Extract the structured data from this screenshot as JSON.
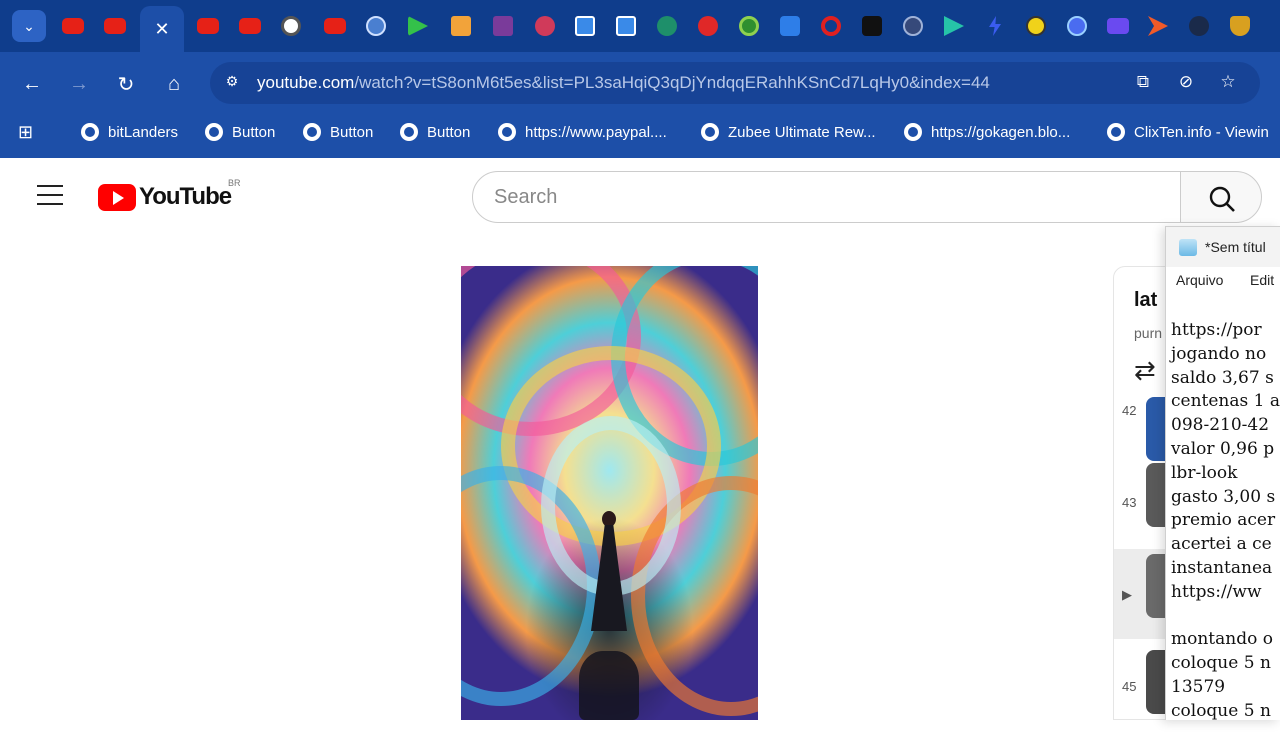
{
  "browser": {
    "tab_count_icons": [
      "youtube-favicon",
      "youtube-favicon",
      "close-tab",
      "youtube-favicon",
      "youtube-favicon",
      "wordpress-favicon",
      "youtube-favicon",
      "globe-favicon",
      "play-favicon",
      "orange-favicon",
      "shield-favicon",
      "red-circle-favicon",
      "blue-square-favicon",
      "blue-square-favicon",
      "green-t-favicon",
      "red-heart-favicon",
      "green-circle-favicon",
      "c-favicon",
      "red-swirl-favicon",
      "tiktok-favicon",
      "dark-globe-favicon",
      "teal-play-favicon",
      "blue-bolt-favicon",
      "yellow-check-favicon",
      "c-blue-favicon",
      "purple-video-favicon",
      "orange-arrow-favicon",
      "dark-circle-favicon",
      "gold-shield-favicon"
    ],
    "active_tab_close": "✕",
    "url_domain": "youtube.com",
    "url_rest": "/watch?v=tS8onM6t5es&list=PL3saHqiQ3qDjYndqqERahhKSnCd7LqHy0&index=44",
    "bookmarks": [
      "bitLanders",
      "Button",
      "Button",
      "Button",
      "https://www.paypal....",
      "Zubee Ultimate Rew...",
      "https://gokagen.blo...",
      "ClixTen.info - Viewin"
    ],
    "colors": {
      "frame": "#1d4fa8",
      "tabstrip": "#0f3d8c"
    }
  },
  "youtube": {
    "logo_text": "YouTube",
    "country_code": "BR",
    "search_placeholder": "Search"
  },
  "playlist": {
    "title": "lat",
    "owner": "purn",
    "rows": [
      {
        "index": "42",
        "active": false
      },
      {
        "index": "43",
        "active": false
      },
      {
        "index": "▶",
        "active": true
      },
      {
        "index": "45",
        "active": false
      }
    ]
  },
  "notepad": {
    "title": "*Sem títul",
    "menu_file": "Arquivo",
    "menu_edit": "Edit",
    "lines": [
      "https://por",
      "jogando no ",
      "saldo 3,67 s",
      "centenas 1 a",
      "098-210-42",
      "valor 0,96 p",
      "lbr-look",
      "gasto 3,00 s",
      "premio acer",
      "acertei a ce",
      "instantanea",
      "https://ww",
      "",
      "montando o",
      "coloque 5 n",
      "13579",
      "coloque 5 n"
    ]
  }
}
